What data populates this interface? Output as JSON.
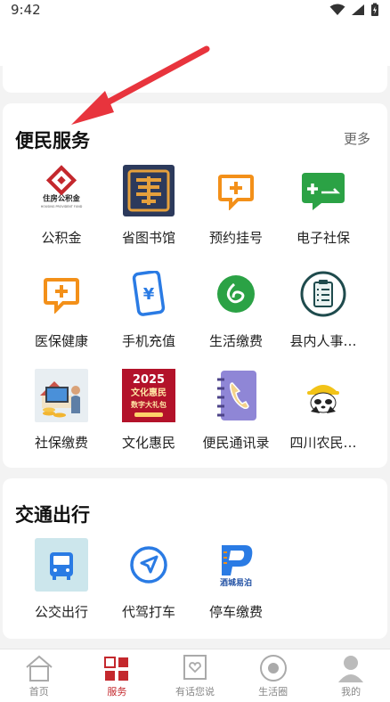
{
  "status_bar": {
    "time": "9:42"
  },
  "service_section": {
    "title": "便民服务",
    "more": "更多",
    "items": [
      {
        "label": "公积金",
        "icon": "housing-fund-logo-icon",
        "logo_text": "住房公积金",
        "logo_subtext": "HOUSING PROVIDENT FUND"
      },
      {
        "label": "省图书馆",
        "icon": "library-seal-icon"
      },
      {
        "label": "预约挂号",
        "icon": "appointment-icon"
      },
      {
        "label": "电子社保",
        "icon": "social-security-card-icon"
      },
      {
        "label": "医保健康",
        "icon": "medical-insurance-icon"
      },
      {
        "label": "手机充值",
        "icon": "phone-recharge-icon",
        "glyph": "¥"
      },
      {
        "label": "生活缴费",
        "icon": "life-payment-icon"
      },
      {
        "label": "县内人事…",
        "icon": "personnel-checklist-icon"
      },
      {
        "label": "社保缴费",
        "icon": "social-insurance-payment-icon"
      },
      {
        "label": "文化惠民",
        "icon": "culture-poster-icon",
        "poster_year": "2025",
        "poster_line1": "文化惠民",
        "poster_line2": "数字大礼包"
      },
      {
        "label": "便民通讯录",
        "icon": "phonebook-icon"
      },
      {
        "label": "四川农民…",
        "icon": "farmer-panda-icon"
      }
    ]
  },
  "traffic_section": {
    "title": "交通出行",
    "items": [
      {
        "label": "公交出行",
        "icon": "bus-icon"
      },
      {
        "label": "代驾打车",
        "icon": "navigation-arrow-icon"
      },
      {
        "label": "停车缴费",
        "icon": "parking-logo-icon",
        "logo_text": "酒城易泊"
      }
    ]
  },
  "bottom_nav": [
    {
      "label": "首页",
      "icon": "home-icon",
      "active": false
    },
    {
      "label": "服务",
      "icon": "service-grid-icon",
      "active": true
    },
    {
      "label": "有话您说",
      "icon": "feedback-icon",
      "active": false
    },
    {
      "label": "生活圈",
      "icon": "life-circle-icon",
      "active": false
    },
    {
      "label": "我的",
      "icon": "profile-icon",
      "active": false
    }
  ],
  "colors": {
    "accent": "#c4282d",
    "green": "#2ba245",
    "orange": "#f39019",
    "blue": "#2a7be4"
  }
}
